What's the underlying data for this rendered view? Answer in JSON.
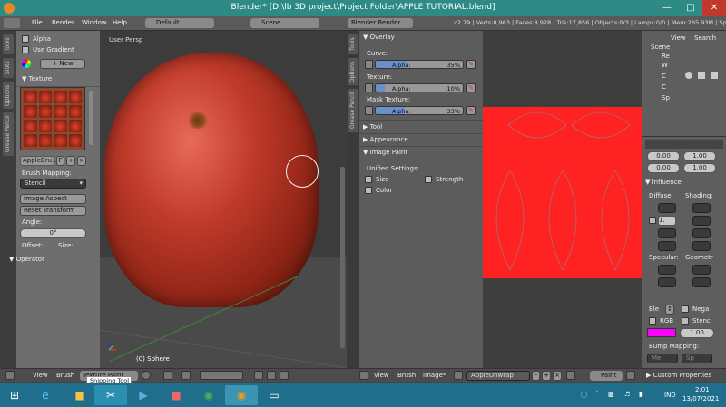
{
  "window": {
    "title": "Blender* [D:\\lb 3D project\\Project Folder\\APPLE TUTORIAL.blend]"
  },
  "topbar": {
    "menus": [
      "File",
      "Render",
      "Window",
      "Help"
    ],
    "layout": "Default",
    "scene": "Scene",
    "engine": "Blender Render",
    "stats": "v2.79 | Verts:8,963 | Faces:8,928 | Tris:17,856 | Objects:0/3 | Lamps:0/0 | Mem:265.93M | Sphere"
  },
  "left_tabs": [
    "Tools",
    "Slots",
    "Options",
    "Grease Pencil"
  ],
  "left_panel": {
    "alpha_label": "Alpha",
    "use_gradient_label": "Use Gradient",
    "new_button": "New",
    "texture_header": "Texture",
    "brush_name": "AppleBru...",
    "f_label": "F",
    "brush_mapping_label": "Brush Mapping:",
    "brush_mapping_value": "Stencil",
    "image_aspect_button": "Image Aspect",
    "reset_transform_button": "Reset Transform",
    "angle_label": "Angle:",
    "angle_value": "0°",
    "offset_label": "Offset:",
    "size_label": "Size:",
    "operator_header": "Operator"
  },
  "viewport": {
    "label": "User Persp",
    "object_label": "(0) Sphere"
  },
  "viewport_bottom": {
    "menus": [
      "View",
      "Brush"
    ],
    "mode": "Texture Paint"
  },
  "props_tabs": [
    "Tools",
    "Options",
    "Grease Pencil"
  ],
  "props": {
    "overlay_header": "Overlay",
    "curve_label": "Curve:",
    "curve_slider_label": "Alpha:",
    "curve_value": "35%",
    "curve_fraction": 0.35,
    "texture_label": "Texture:",
    "texture_slider_label": "Alpha:",
    "texture_value": "10%",
    "texture_fraction": 0.1,
    "mask_label": "Mask Texture:",
    "mask_slider_label": "Alpha:",
    "mask_value": "33%",
    "mask_fraction": 0.33,
    "tool_header": "Tool",
    "appearance_header": "Appearance",
    "image_paint_header": "Image Paint",
    "unified_label": "Unified Settings:",
    "size_check": "Size",
    "strength_check": "Strength",
    "color_check": "Color"
  },
  "uv_bottom": {
    "menus": [
      "View",
      "Brush",
      "Image*"
    ],
    "image_name": "AppleUnwrap",
    "f_label": "F",
    "paint_mode": "Paint"
  },
  "right_panel": {
    "view_tab": "View",
    "search_tab": "Search",
    "outliner_items": [
      "Scene",
      "Re",
      "W",
      "C",
      "C",
      "Sp"
    ],
    "val_a": "0.00",
    "val_b": "1.00",
    "val_c": "0.00",
    "val_d": "1.00",
    "influence_header": "Influence",
    "diffuse_label": "Diffuse:",
    "shading_label": "Shading:",
    "one": "1.",
    "one_b": "1.",
    "specular_label": "Specular:",
    "geometry_label": "Geometr",
    "blend_label": "Ble",
    "negative_label": "Nega",
    "rgb_label": "RGB",
    "stencil_label": "Stenc",
    "color_value": "1.00",
    "bump_mapping_label": "Bump Mapping:",
    "method_label": "Me",
    "space_label": "Sp",
    "custom_props_header": "Custom Properties",
    "magenta": "#ff00ff"
  },
  "tooltip": "Snipping Tool",
  "taskbar": {
    "lang": "IND",
    "time": "2:01",
    "date": "13/07/2021"
  },
  "colors": {
    "titlebar": "#2d8a84",
    "taskbar": "#1e6e8c",
    "uv_red": "#ff2222",
    "slider_fill": "#6b8fc8"
  }
}
